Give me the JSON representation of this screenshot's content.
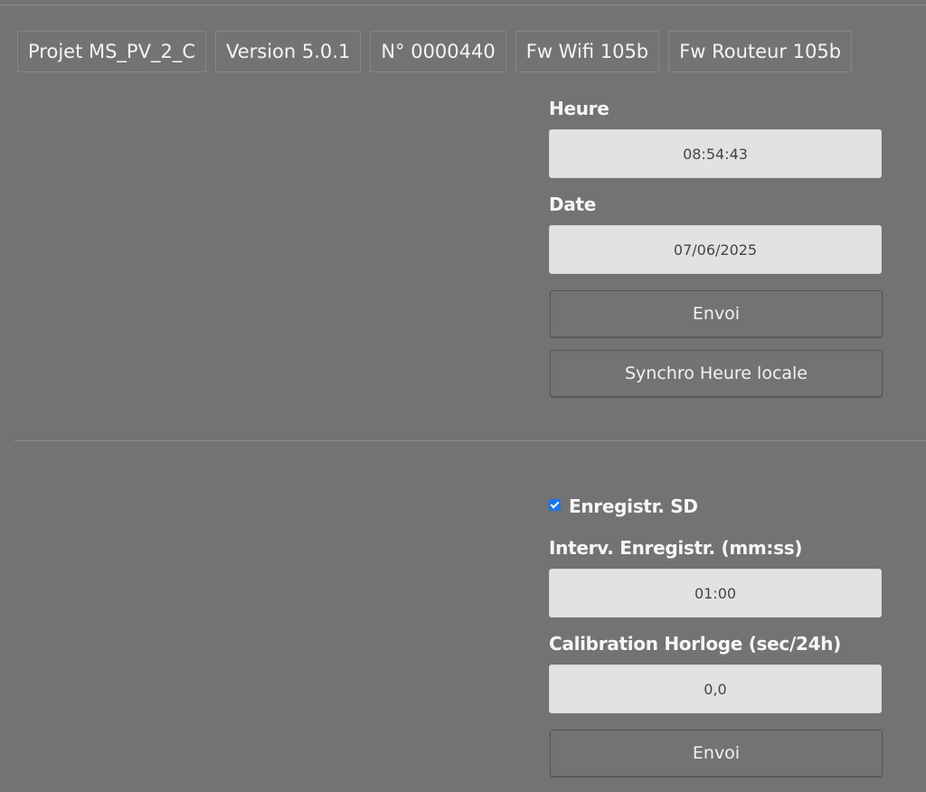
{
  "header": {
    "tags": [
      "Projet MS_PV_2_C",
      "Version 5.0.1",
      "N° 0000440",
      "Fw Wifi 105b",
      "Fw Routeur 105b"
    ]
  },
  "clock": {
    "heure_label": "Heure",
    "heure_value": "08:54:43",
    "date_label": "Date",
    "date_value": "07/06/2025",
    "send_label": "Envoi",
    "sync_label": "Synchro Heure locale"
  },
  "recording": {
    "sd_label": "Enregistr. SD",
    "sd_checked": true,
    "interval_label": "Interv. Enregistr. (mm:ss)",
    "interval_value": "01:00",
    "calibration_label": "Calibration Horloge (sec/24h)",
    "calibration_value": "0,0",
    "send_label": "Envoi"
  },
  "colors": {
    "accent": "#1976e8",
    "background": "#737373",
    "field": "#e2e2e2"
  }
}
